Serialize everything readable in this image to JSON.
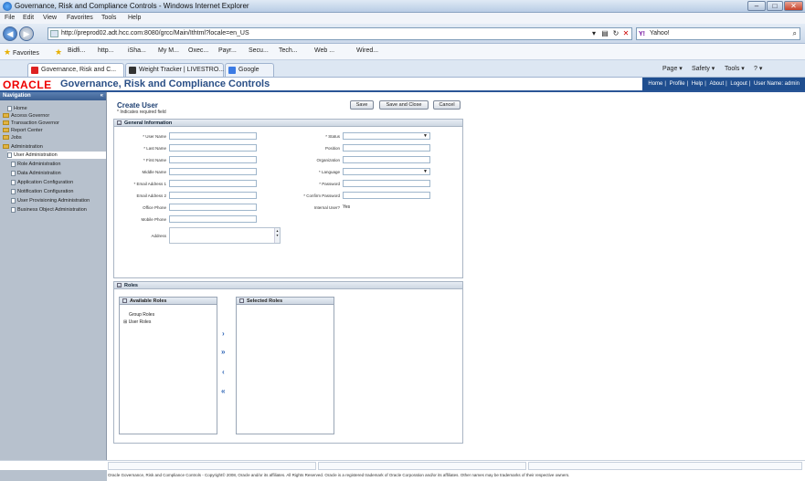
{
  "window": {
    "title": "Governance, Risk and Compliance Controls - Windows Internet Explorer",
    "min": "–",
    "max": "□",
    "close": "✕"
  },
  "menu": [
    "File",
    "Edit",
    "View",
    "Favorites",
    "Tools",
    "Help"
  ],
  "address": {
    "url": "http://preprod02.adt.hcc.com:8080/grcc/Main/Ithtml?locale=en_US",
    "search_engine": "Y!",
    "search_placeholder": "Yahoo!"
  },
  "favorites": {
    "label": "Favorites",
    "items": [
      "Bidfi...",
      "http...",
      "iSha...",
      "My M...",
      "Oxec...",
      "Payr...",
      "Secu...",
      "Tech...",
      "Web ...",
      "Wired..."
    ]
  },
  "tabs": [
    {
      "label": "Governance, Risk and C..."
    },
    {
      "label": "Weight Tracker | LIVESTRO..."
    },
    {
      "label": "Google"
    }
  ],
  "ie_commands": [
    "Page ▾",
    "Safety ▾",
    "Tools ▾",
    "? ▾"
  ],
  "oracle": {
    "logo": "ORACLE",
    "app_title": "Governance, Risk and Compliance Controls",
    "global_links": [
      "Home",
      "Profile",
      "Help",
      "About",
      "Logout",
      "User Name: admin"
    ]
  },
  "sidebar": {
    "header": "Navigation",
    "items": [
      {
        "label": "Home",
        "kind": "doc",
        "level": 1
      },
      {
        "label": "Access Governor",
        "kind": "folder",
        "level": 0
      },
      {
        "label": "Transaction Governor",
        "kind": "folder",
        "level": 0
      },
      {
        "label": "Report Center",
        "kind": "folder",
        "level": 0
      },
      {
        "label": "Jobs",
        "kind": "folder",
        "level": 0
      },
      {
        "label": "Administration",
        "kind": "folder",
        "level": 0
      },
      {
        "label": "User Administration",
        "kind": "doc",
        "level": 1
      },
      {
        "label": "Role Administration",
        "kind": "doc",
        "level": 1
      },
      {
        "label": "Data Administration",
        "kind": "doc",
        "level": 1
      },
      {
        "label": "Application Configuration",
        "kind": "doc",
        "level": 1
      },
      {
        "label": "Notification Configuration",
        "kind": "doc",
        "level": 1
      },
      {
        "label": "User Provisioning Administration",
        "kind": "doc",
        "level": 1
      },
      {
        "label": "Business Object Administration",
        "kind": "doc",
        "level": 1
      }
    ]
  },
  "page": {
    "title": "Create User",
    "required_note": "* Indicates required field",
    "buttons": {
      "save": "Save",
      "save_close": "Save and Close",
      "cancel": "Cancel"
    }
  },
  "general": {
    "header": "General Information",
    "left_fields": [
      "* User Name",
      "* Last Name",
      "* First Name",
      "Middle Name",
      "* Email Address 1",
      "Email Address 2",
      "Office Phone",
      "Mobile Phone",
      "Address"
    ],
    "right_fields": [
      "* Status",
      "Position",
      "Organization",
      "* Language",
      "* Password",
      "* Confirm Password",
      "Internal User?"
    ],
    "internal_user_value": "Yes"
  },
  "roles": {
    "header": "Roles",
    "available_header": "Available Roles",
    "selected_header": "Selected Roles",
    "tree": [
      "Group Roles",
      "User Roles"
    ]
  },
  "footer": {
    "copyright": "Oracle Governance, Risk and Compliance Controls - Copyright© 2008, Oracle and/or its affiliates. All Rights Reserved. Oracle is a registered trademark of Oracle Corporation and/or its affiliates. Other names may be trademarks of their respective owners."
  }
}
